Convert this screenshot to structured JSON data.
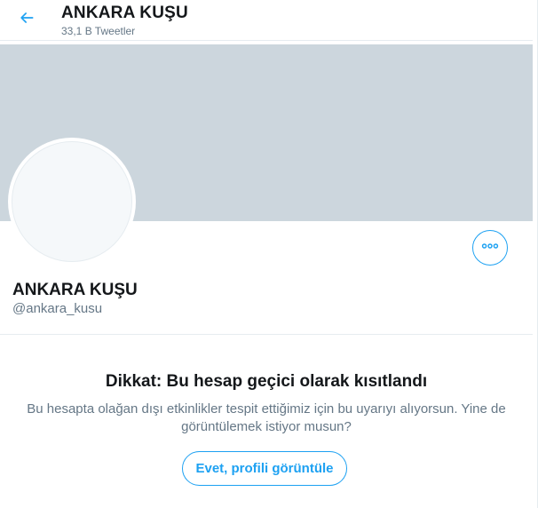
{
  "header": {
    "title": "ANKARA KUŞU",
    "tweet_count": "33,1 B Tweetler",
    "back_icon": "arrow-left-icon"
  },
  "profile": {
    "name": "ANKARA KUŞU",
    "handle": "@ankara_kusu",
    "more_icon": "more-horizontal-icon"
  },
  "warning": {
    "title": "Dikkat: Bu hesap geçici olarak kısıtlandı",
    "body": "Bu hesapta olağan dışı etkinlikler tespit ettiğimiz için bu uyarıyı alıyorsun. Yine de görüntülemek istiyor musun?",
    "button_label": "Evet, profili görüntüle"
  },
  "colors": {
    "accent": "#1da1f2",
    "banner": "#ccd6dd",
    "secondary_text": "#657786"
  }
}
